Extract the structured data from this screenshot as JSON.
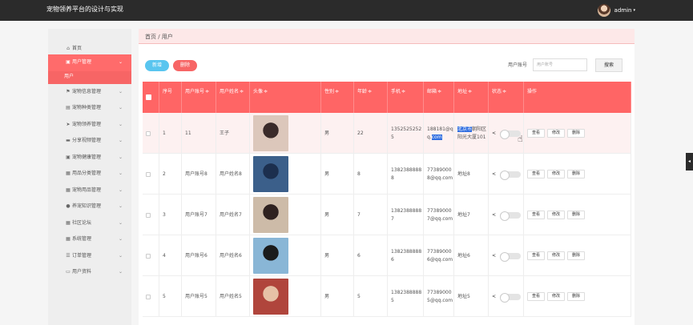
{
  "app": {
    "title": "宠物领养平台的设计与实现",
    "user": "admin"
  },
  "sidebar": {
    "items": [
      {
        "icon": "home-icon",
        "glyph": "⌂",
        "label": "首页"
      },
      {
        "icon": "user-icon",
        "glyph": "▣",
        "label": "用户管理",
        "active": true,
        "chevron": "⌄"
      },
      {
        "label": "用户",
        "child": true
      },
      {
        "icon": "flag-icon",
        "glyph": "⚑",
        "label": "宠物信息管理",
        "chevron": "⌄"
      },
      {
        "icon": "print-icon",
        "glyph": "▤",
        "label": "宠物种类管理",
        "chevron": "⌄"
      },
      {
        "icon": "send-icon",
        "glyph": "➤",
        "label": "宠物领养管理",
        "chevron": "⌄"
      },
      {
        "icon": "video-icon",
        "glyph": "▬",
        "label": "分享视频管理",
        "chevron": "⌄"
      },
      {
        "icon": "briefcase-icon",
        "glyph": "▣",
        "label": "宠物健康管理",
        "chevron": "⌄"
      },
      {
        "icon": "grid-icon",
        "glyph": "▦",
        "label": "用品分类管理",
        "chevron": "⌄"
      },
      {
        "icon": "grid-icon",
        "glyph": "▦",
        "label": "宠物用品管理",
        "chevron": "⌄"
      },
      {
        "icon": "pin-icon",
        "glyph": "●",
        "label": "养宠知识管理",
        "chevron": "⌄"
      },
      {
        "icon": "grid-icon",
        "glyph": "▦",
        "label": "社区论坛",
        "chevron": "⌄"
      },
      {
        "icon": "grid-icon",
        "glyph": "▦",
        "label": "系统管理",
        "chevron": "⌄"
      },
      {
        "icon": "list-icon",
        "glyph": "☰",
        "label": "订单管理",
        "chevron": "⌄"
      },
      {
        "icon": "calendar-icon",
        "glyph": "▭",
        "label": "用户资料",
        "chevron": "⌄"
      }
    ]
  },
  "breadcrumb": "首页 / 用户",
  "toolbar": {
    "add_label": "新增",
    "delete_label": "删除"
  },
  "search": {
    "label": "用户账号",
    "placeholder": "用户账号",
    "button": "搜索"
  },
  "table": {
    "columns": [
      {
        "label": ""
      },
      {
        "label": "序号"
      },
      {
        "label": "用户账号",
        "sort": "≑"
      },
      {
        "label": "用户姓名",
        "sort": "≑"
      },
      {
        "label": "头像",
        "sort": "≑"
      },
      {
        "label": "性别",
        "sort": "≑"
      },
      {
        "label": "年龄",
        "sort": "≑"
      },
      {
        "label": "手机",
        "sort": "≑"
      },
      {
        "label": "邮箱",
        "sort": "≑"
      },
      {
        "label": "地址",
        "sort": "≑"
      },
      {
        "label": "状态",
        "sort": "≑"
      },
      {
        "label": "操作"
      }
    ],
    "actions": {
      "view": "查看",
      "edit": "修改",
      "delete": "删除"
    },
    "rows": [
      {
        "index": "1",
        "account": "11",
        "name": "王子",
        "gender": "男",
        "age": "22",
        "phone": "13525252525",
        "email_pre": "188181@",
        "email_mid": "qq.",
        "email_hl": "com",
        "addr_hl": "北京市",
        "addr_rest": "朝阳区阳光大厦101",
        "photo": [
          "#dcc7bb",
          "#3a2b2a"
        ]
      },
      {
        "index": "2",
        "account": "用户账号8",
        "name": "用户姓名8",
        "gender": "男",
        "age": "8",
        "phone": "13823888888",
        "email": "773890008@qq.com",
        "address": "地址8",
        "photo": [
          "#3b5f8a",
          "#1c2f4e"
        ]
      },
      {
        "index": "3",
        "account": "用户账号7",
        "name": "用户姓名7",
        "gender": "男",
        "age": "7",
        "phone": "13823888887",
        "email": "773890007@qq.com",
        "address": "地址7",
        "photo": [
          "#cdbba8",
          "#2f2220"
        ]
      },
      {
        "index": "4",
        "account": "用户账号6",
        "name": "用户姓名6",
        "gender": "男",
        "age": "6",
        "phone": "13823888886",
        "email": "773890006@qq.com",
        "address": "地址6",
        "photo": [
          "#89b6d6",
          "#1b1b1b"
        ]
      },
      {
        "index": "5",
        "account": "用户账号5",
        "name": "用户姓名5",
        "gender": "男",
        "age": "5",
        "phone": "13823888885",
        "email": "773890005@qq.com",
        "address": "地址5",
        "photo": [
          "#b0453c",
          "#e6c1a6"
        ]
      }
    ]
  },
  "colors": {
    "primary": "#ff6565",
    "add_button": "#59c5ef",
    "topbar": "#2b2b2b"
  }
}
